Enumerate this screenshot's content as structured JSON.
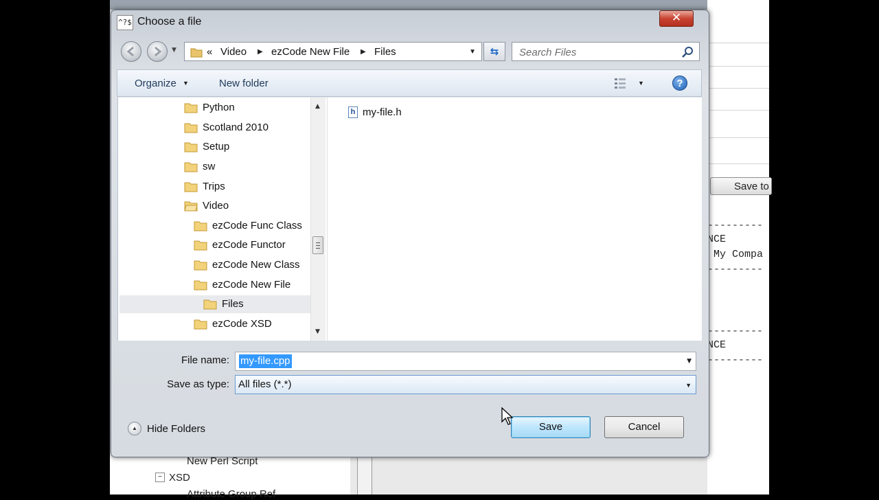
{
  "background": {
    "save_button": "Save to",
    "code_line1": "NCE",
    "code_line2": " My Compa",
    "code_line3": "NCE",
    "tree_item1": "New Perl Script",
    "tree_item2": "XSD",
    "tree_item3": "Attribute Group Ref"
  },
  "dialog": {
    "title": "Choose a file",
    "title_icon_text": "^?$",
    "close_label": "✕",
    "address": {
      "prefix": "«",
      "segments": [
        "Video",
        "ezCode New File",
        "Files"
      ]
    },
    "search_placeholder": "Search Files",
    "toolbar": {
      "organize": "Organize",
      "new_folder": "New folder",
      "help": "?"
    },
    "nav_tree": [
      {
        "label": "Python"
      },
      {
        "label": "Scotland 2010"
      },
      {
        "label": "Setup"
      },
      {
        "label": "sw"
      },
      {
        "label": "Trips"
      },
      {
        "label": "Video"
      },
      {
        "label": "ezCode Func Class"
      },
      {
        "label": "ezCode Functor"
      },
      {
        "label": "ezCode New Class"
      },
      {
        "label": "ezCode New File"
      },
      {
        "label": "Files",
        "selected": true
      },
      {
        "label": "ezCode XSD"
      }
    ],
    "files": [
      {
        "name": "my-file.h",
        "icon": "h-file-icon"
      }
    ],
    "file_name_label": "File name:",
    "file_name_value": "my-file.cpp",
    "save_as_type_label": "Save as type:",
    "save_as_type_value": "All files (*.*)",
    "hide_folders": "Hide Folders",
    "save_button": "Save",
    "cancel_button": "Cancel"
  }
}
